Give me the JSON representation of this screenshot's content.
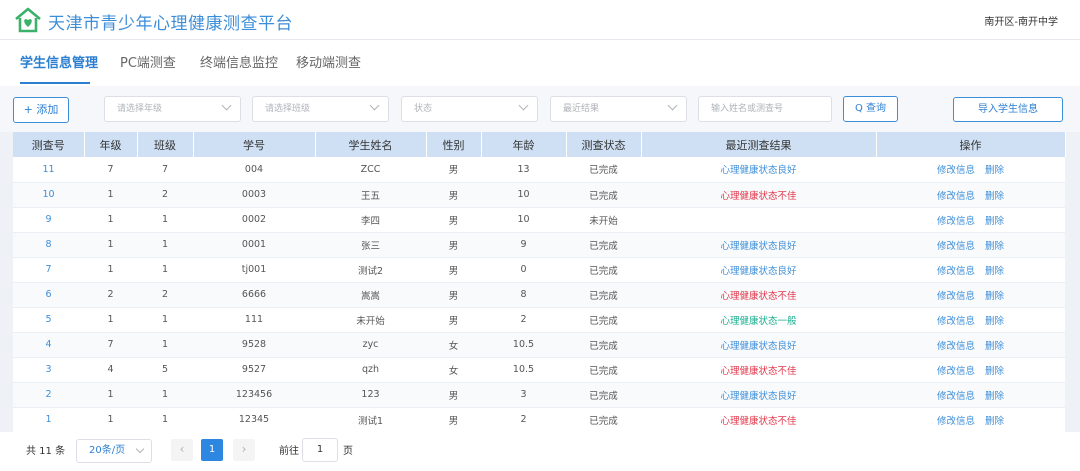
{
  "header": {
    "title": "天津市青少年心理健康测查平台",
    "school": "南开区-南开中学",
    "logo_icon": "house-heart-icon"
  },
  "tabs": [
    {
      "label": "学生信息管理",
      "active": true
    },
    {
      "label": "PC端测查",
      "active": false
    },
    {
      "label": "终端信息监控",
      "active": false
    },
    {
      "label": "移动端测查",
      "active": false
    }
  ],
  "toolbar": {
    "add_label": "+ 添加",
    "grade_placeholder": "请选择年级",
    "class_placeholder": "请选择班级",
    "status_placeholder": "状态",
    "result_placeholder": "最近结果",
    "search_placeholder": "输入姓名或测查号",
    "search_label": "Q 查询",
    "import_label": "导入学生信息"
  },
  "table": {
    "columns": [
      "测查号",
      "年级",
      "班级",
      "学号",
      "学生姓名",
      "性别",
      "年龄",
      "测查状态",
      "最近测查结果",
      "操作"
    ],
    "edit_label": "修改信息",
    "delete_label": "删除",
    "rows": [
      {
        "id": "11",
        "grade": "7",
        "class": "7",
        "sno": "004",
        "name": "ZCC",
        "gender": "男",
        "age": "13",
        "status": "已完成",
        "result": "心理健康状态良好",
        "level": "good"
      },
      {
        "id": "10",
        "grade": "1",
        "class": "2",
        "sno": "0003",
        "name": "王五",
        "gender": "男",
        "age": "10",
        "status": "已完成",
        "result": "心理健康状态不佳",
        "level": "bad"
      },
      {
        "id": "9",
        "grade": "1",
        "class": "1",
        "sno": "0002",
        "name": "李四",
        "gender": "男",
        "age": "10",
        "status": "未开始",
        "result": "",
        "level": "none"
      },
      {
        "id": "8",
        "grade": "1",
        "class": "1",
        "sno": "0001",
        "name": "张三",
        "gender": "男",
        "age": "9",
        "status": "已完成",
        "result": "心理健康状态良好",
        "level": "good"
      },
      {
        "id": "7",
        "grade": "1",
        "class": "1",
        "sno": "tj001",
        "name": "测试2",
        "gender": "男",
        "age": "0",
        "status": "已完成",
        "result": "心理健康状态良好",
        "level": "good"
      },
      {
        "id": "6",
        "grade": "2",
        "class": "2",
        "sno": "6666",
        "name": "嵩嵩",
        "gender": "男",
        "age": "8",
        "status": "已完成",
        "result": "心理健康状态不佳",
        "level": "bad"
      },
      {
        "id": "5",
        "grade": "1",
        "class": "1",
        "sno": "111",
        "name": "未开始",
        "gender": "男",
        "age": "2",
        "status": "已完成",
        "result": "心理健康状态一般",
        "level": "mid"
      },
      {
        "id": "4",
        "grade": "7",
        "class": "1",
        "sno": "9528",
        "name": "zyc",
        "gender": "女",
        "age": "10.5",
        "status": "已完成",
        "result": "心理健康状态良好",
        "level": "good"
      },
      {
        "id": "3",
        "grade": "4",
        "class": "5",
        "sno": "9527",
        "name": "qzh",
        "gender": "女",
        "age": "10.5",
        "status": "已完成",
        "result": "心理健康状态不佳",
        "level": "bad"
      },
      {
        "id": "2",
        "grade": "1",
        "class": "1",
        "sno": "123456",
        "name": "123",
        "gender": "男",
        "age": "3",
        "status": "已完成",
        "result": "心理健康状态良好",
        "level": "good"
      },
      {
        "id": "1",
        "grade": "1",
        "class": "1",
        "sno": "12345",
        "name": "测试1",
        "gender": "男",
        "age": "2",
        "status": "已完成",
        "result": "心理健康状态不佳",
        "level": "bad"
      }
    ]
  },
  "pager": {
    "total": "共 11 条",
    "page_size": "20条/页",
    "current_page": "1",
    "goto_label": "前往",
    "goto_value": "1",
    "page_unit": "页",
    "prev": "‹",
    "next": "›"
  },
  "colors": {
    "accent": "#2d7fd2",
    "good": "#3d8ed8",
    "bad": "#e2374a",
    "mid": "#1aad8e",
    "header_bg": "#cfe0f4"
  }
}
